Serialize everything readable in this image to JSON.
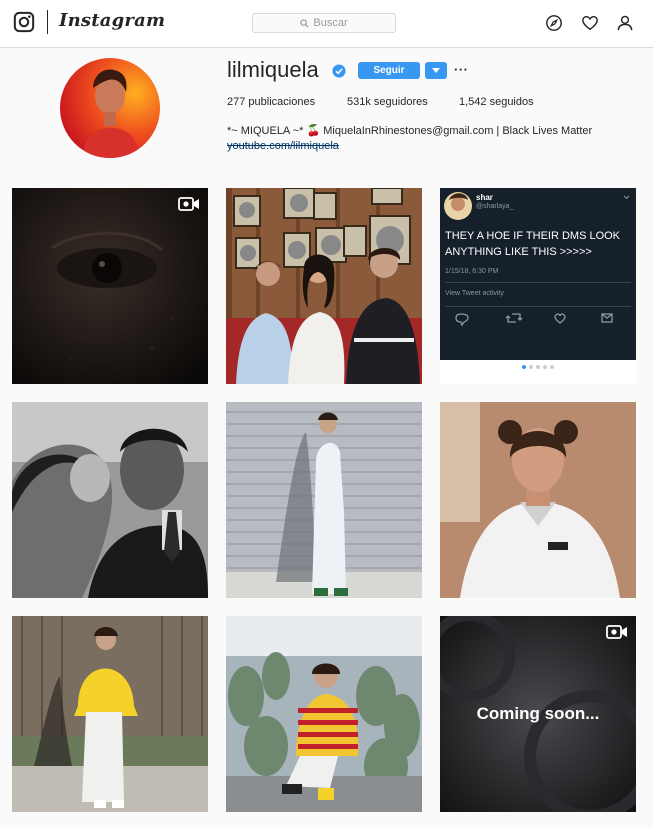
{
  "header": {
    "logo_icon": "instagram-camera-icon",
    "wordmark": "Instagram",
    "search_placeholder": "Buscar",
    "nav_icons": [
      "compass-icon",
      "heart-icon",
      "person-icon"
    ]
  },
  "profile": {
    "username": "lilmiquela",
    "verified": true,
    "follow_label": "Seguir",
    "more_label": "···",
    "stats": {
      "posts": "277 publicaciones",
      "followers": "531k seguidores",
      "following": "1,542 seguidos"
    },
    "bio": "*~ MIQUELA ~* 🍒 MiquelaInRhinestones@gmail.com | Black Lives Matter",
    "link": "youtube.com/lilmiquela"
  },
  "posts": [
    {
      "label": "Close-up of an eye",
      "video": true
    },
    {
      "label": "Three people in a record room",
      "video": false
    },
    {
      "label": "Tweet screenshot",
      "video": false,
      "tweet": {
        "name": "shar",
        "handle": "@sharlaya_",
        "text": "THEY A HOE IF THEIR DMS LOOK ANYTHING LIKE THIS >>>>>",
        "time": "1/15/18, 6:30 PM",
        "activity": "View Tweet activity"
      }
    },
    {
      "label": "Black and white photo of a kiss on the cheek",
      "video": false
    },
    {
      "label": "Person in white jumpsuit against shutter",
      "video": false
    },
    {
      "label": "Portrait in white shirt",
      "video": false
    },
    {
      "label": "Person in yellow hoodie",
      "video": false
    },
    {
      "label": "Sitting among cactus plants",
      "video": false
    },
    {
      "label": "Coming soon video",
      "video": true,
      "overlay": "Coming soon..."
    }
  ],
  "colors": {
    "accent": "#3897f0",
    "border": "#dbdbdb",
    "background": "#fafafa",
    "tweet_bg": "#15202b"
  }
}
